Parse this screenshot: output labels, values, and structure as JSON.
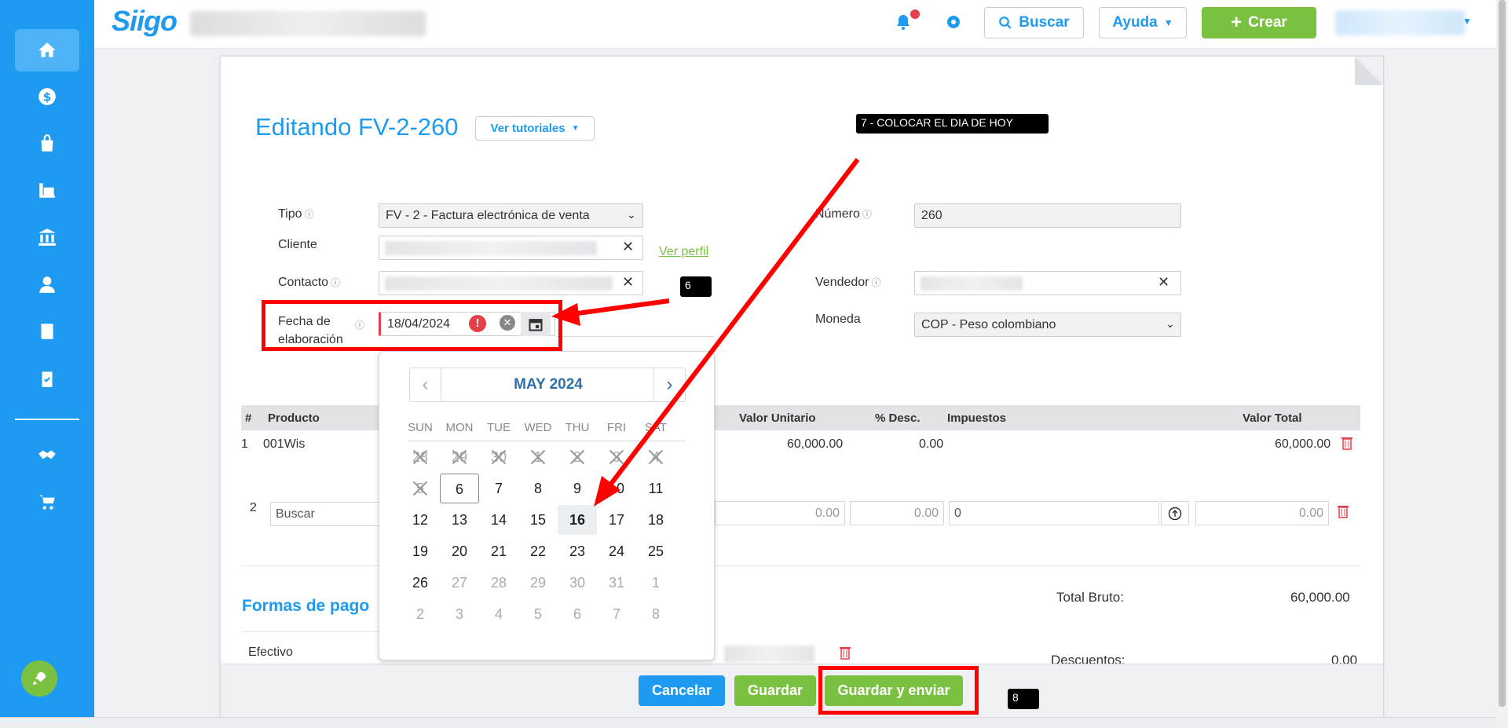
{
  "app": {
    "logo_text": "Siigo"
  },
  "topbar": {
    "search_label": "Buscar",
    "help_label": "Ayuda",
    "create_label": "Crear"
  },
  "page": {
    "title": "Editando FV-2-260",
    "tutorials_label": "Ver tutoriales"
  },
  "form": {
    "tipo_label": "Tipo",
    "tipo_value": "FV - 2 - Factura electrónica de venta",
    "cliente_label": "Cliente",
    "ver_perfil": "Ver perfil",
    "contacto_label": "Contacto",
    "fecha_label_1": "Fecha de",
    "fecha_label_2": "elaboración",
    "fecha_value": "18/04/2024",
    "numero_label": "Número",
    "numero_value": "260",
    "vendedor_label": "Vendedor",
    "moneda_label": "Moneda",
    "moneda_value": "COP - Peso colombiano"
  },
  "calendar": {
    "month_label": "MAY 2024",
    "weekdays": [
      "SUN",
      "MON",
      "TUE",
      "WED",
      "THU",
      "FRI",
      "SAT"
    ],
    "weeks": [
      [
        "28",
        "29",
        "30",
        "1",
        "2",
        "3",
        "4"
      ],
      [
        "5",
        "6",
        "7",
        "8",
        "9",
        "10",
        "11"
      ],
      [
        "12",
        "13",
        "14",
        "15",
        "16",
        "17",
        "18"
      ],
      [
        "19",
        "20",
        "21",
        "22",
        "23",
        "24",
        "25"
      ],
      [
        "26",
        "27",
        "28",
        "29",
        "30",
        "31",
        "1"
      ],
      [
        "2",
        "3",
        "4",
        "5",
        "6",
        "7",
        "8"
      ]
    ],
    "selected_day": "6",
    "today": "16"
  },
  "table": {
    "headers": {
      "num": "#",
      "product": "Producto",
      "unit_value": "Valor Unitario",
      "discount": "% Desc.",
      "taxes": "Impuestos",
      "total": "Valor Total"
    },
    "row1": {
      "num": "1",
      "product": "001Wis",
      "unit_value": "60,000.00",
      "discount": "0.00",
      "total": "60,000.00"
    },
    "row2": {
      "num": "2",
      "product_placeholder": "Buscar",
      "unit_value": "0.00",
      "discount": "0.00",
      "taxes": "0",
      "total": "0.00"
    }
  },
  "payments": {
    "title": "Formas de pago",
    "efectivo_label": "Efectivo"
  },
  "totals": {
    "bruto_label": "Total Bruto:",
    "bruto_value": "60,000.00",
    "descuentos_label": "Descuentos:",
    "descuentos_value": "0.00"
  },
  "footer": {
    "cancel_label": "Cancelar",
    "save_label": "Guardar",
    "save_send_label": "Guardar y enviar"
  },
  "annotations": {
    "step6": "6",
    "step7": "7 - COLOCAR EL DIA DE HOY",
    "step8": "8"
  },
  "colors": {
    "primary": "#1e9bf0",
    "success": "#7ac142",
    "annotation": "#ff0000"
  }
}
